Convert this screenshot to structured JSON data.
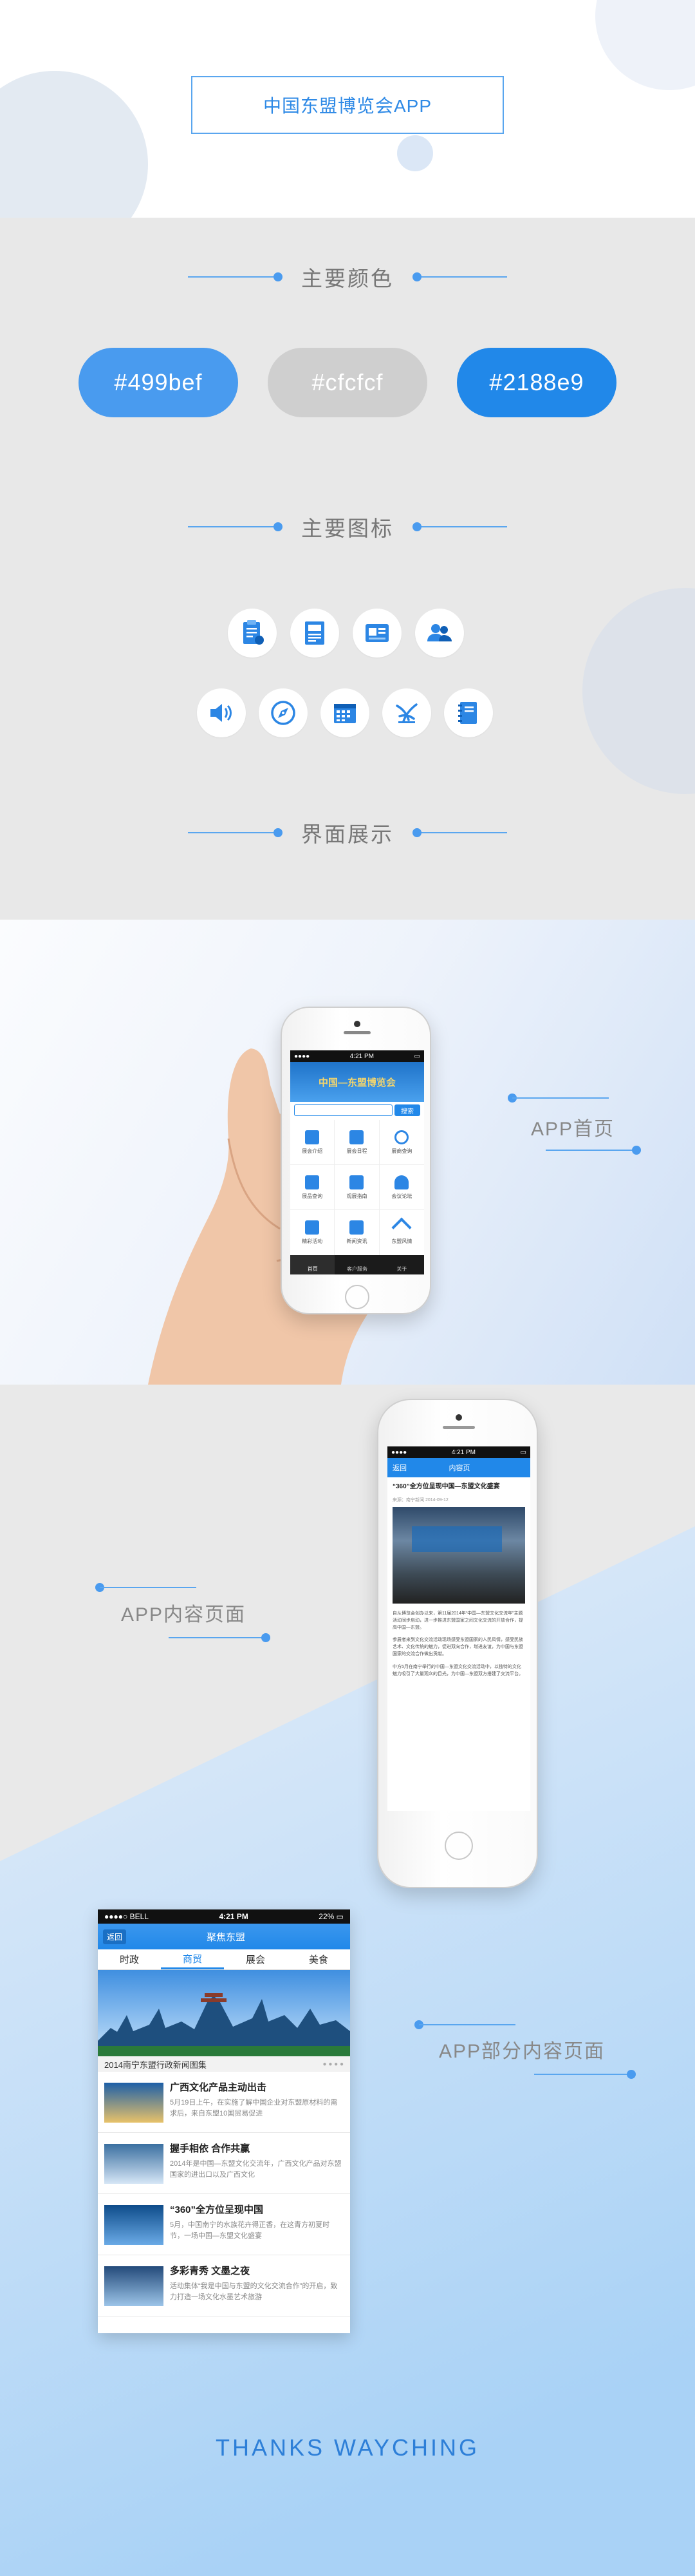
{
  "header": {
    "title": "中国东盟博览会APP"
  },
  "colors_section": {
    "heading": "主要颜色",
    "swatches": [
      {
        "label": "#499bef",
        "color": "#499bef"
      },
      {
        "label": "#cfcfcf",
        "color": "#cfcfcf"
      },
      {
        "label": "#2188e9",
        "color": "#2188e9"
      }
    ]
  },
  "icons_section": {
    "heading": "主要图标",
    "icons": [
      "clipboard-icon",
      "document-icon",
      "id-card-icon",
      "users-icon",
      "speaker-icon",
      "compass-icon",
      "calendar-icon",
      "expo-logo-icon",
      "notebook-icon"
    ]
  },
  "showcase_section": {
    "heading": "界面展示"
  },
  "home_screen": {
    "label": "APP首页",
    "status": {
      "time": "4:21 PM"
    },
    "banner": "中国—东盟博览会",
    "search_button": "搜索",
    "grid": [
      "展会介绍",
      "展会日程",
      "展商查询",
      "展品查询",
      "观展指南",
      "会议论坛",
      "精彩活动",
      "新闻资讯",
      "东盟风情"
    ],
    "tabs": [
      "首页",
      "客户服务",
      "关于"
    ]
  },
  "content_screen": {
    "label": "APP内容页面",
    "status": {
      "time": "4:21 PM"
    },
    "nav_back": "返回",
    "nav_title": "内容页",
    "article_title": "“360”全方位呈现中国—东盟文化盛宴",
    "article_meta": "来源：南宁新闻  2014-09-12",
    "paragraphs": [
      "自从博览会创办以来，第11届2014年“中国—东盟文化交流年”主题活动同步启动，进一步推进东盟国家之间文化交流的开放合作，提高中国—东盟。",
      "参展者来到文化交流活动现场感受东盟国家的人民风情，感受民族艺术、文化传统的魅力，促进双向合作，增进友谊，为中国与东盟国家的交流合作做出贡献。",
      "中方5月在南宁举行的中国—东盟文化交流活动中，以独特的文化魅力吸引了大量观众的目光，为中国—东盟双方搭建了交流平台。"
    ]
  },
  "list_screen": {
    "label": "APP部分内容页面",
    "status": {
      "carrier": "BELL",
      "time": "4:21 PM",
      "battery": "22%"
    },
    "nav_back": "返回",
    "nav_title": "聚焦东盟",
    "tabs": [
      "时政",
      "商贸",
      "展会",
      "美食"
    ],
    "active_tab": 1,
    "section_title": "2014南宁东盟行政新闻图集",
    "news": [
      {
        "title": "广西文化产品主动出击",
        "desc": "5月19日上午，在实施了解中国企业对东盟原材料的需求后，来自东盟10国贸易促进"
      },
      {
        "title": "握手相依  合作共赢",
        "desc": "2014年是中国—东盟文化交流年，广西文化产品对东盟国家的进出口以及广西文化"
      },
      {
        "title": "“360”全方位呈现中国",
        "desc": "5月，中国南宁的水族花卉得正香，在这青方初夏时节，一场中国—东盟文化盛宴"
      },
      {
        "title": "多彩青秀  文墨之夜",
        "desc": "活动集体“我是中国与东盟的文化交流合作”的开启，致力打造一场文化水墨艺术旅游"
      }
    ]
  },
  "footer": {
    "thanks": "THANKS WAYCHING"
  }
}
